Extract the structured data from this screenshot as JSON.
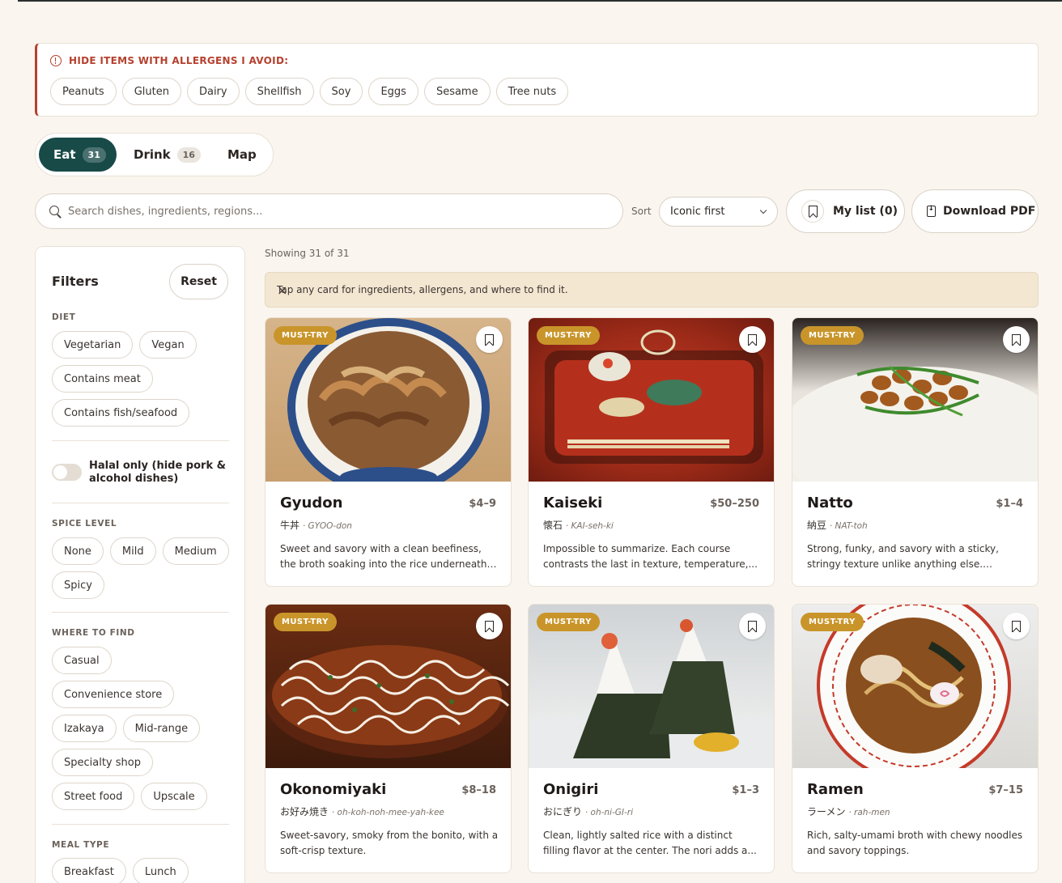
{
  "allergens": {
    "heading": "HIDE ITEMS WITH ALLERGENS I AVOID:",
    "items": [
      "Peanuts",
      "Gluten",
      "Dairy",
      "Shellfish",
      "Soy",
      "Eggs",
      "Sesame",
      "Tree nuts"
    ]
  },
  "tabs": [
    {
      "label": "Eat",
      "count": "31"
    },
    {
      "label": "Drink",
      "count": "16"
    },
    {
      "label": "Map",
      "count": ""
    }
  ],
  "search": {
    "placeholder": "Search dishes, ingredients, regions..."
  },
  "sort": {
    "label": "Sort",
    "value": "Iconic first"
  },
  "actions": {
    "my_list": "My list (0)",
    "download": "Download PDF"
  },
  "filters": {
    "title": "Filters",
    "reset": "Reset",
    "diet_label": "DIET",
    "diet": [
      "Vegetarian",
      "Vegan",
      "Contains meat",
      "Contains fish/seafood"
    ],
    "halal": "Halal only (hide pork & alcohol dishes)",
    "spice_label": "SPICE LEVEL",
    "spice": [
      "None",
      "Mild",
      "Medium",
      "Spicy"
    ],
    "where_label": "WHERE TO FIND",
    "where": [
      "Casual",
      "Convenience store",
      "Izakaya",
      "Mid-range",
      "Specialty shop",
      "Street food",
      "Upscale"
    ],
    "meal_label": "MEAL TYPE",
    "meal": [
      "Breakfast",
      "Lunch"
    ]
  },
  "results": {
    "showing": "Showing 31 of 31",
    "tip": "Tap any card for ingredients, allergens, and where to find it.",
    "badge": "MUST-TRY",
    "cards": [
      {
        "name": "Gyudon",
        "price": "$4–9",
        "jp": "牛丼",
        "romaji": "· GYOO-don",
        "desc": "Sweet and savory with a clean beefiness, the broth soaking into the rice underneath. A ra..."
      },
      {
        "name": "Kaiseki",
        "price": "$50–250",
        "jp": "懐石",
        "romaji": "· KAI-seh-ki",
        "desc": "Impossible to summarize. Each course contrasts the last in texture, temperature,..."
      },
      {
        "name": "Natto",
        "price": "$1–4",
        "jp": "納豆",
        "romaji": "· NAT-toh",
        "desc": "Strong, funky, and savory with a sticky, stringy texture unlike anything else. Mixing..."
      },
      {
        "name": "Okonomiyaki",
        "price": "$8–18",
        "jp": "お好み焼き",
        "romaji": "· oh-koh-noh-mee-yah-kee",
        "desc": "Sweet-savory, smoky from the bonito, with a soft-crisp texture."
      },
      {
        "name": "Onigiri",
        "price": "$1–3",
        "jp": "おにぎり",
        "romaji": "· oh-ni-GI-ri",
        "desc": "Clean, lightly salted rice with a distinct filling flavor at the center. The nori adds a..."
      },
      {
        "name": "Ramen",
        "price": "$7–15",
        "jp": "ラーメン",
        "romaji": "· rah-men",
        "desc": "Rich, salty-umami broth with chewy noodles and savory toppings."
      }
    ]
  },
  "colors": {
    "accent": "#184a48",
    "alert": "#b6412f",
    "badge": "#c9952a",
    "background": "#faf6ef"
  }
}
